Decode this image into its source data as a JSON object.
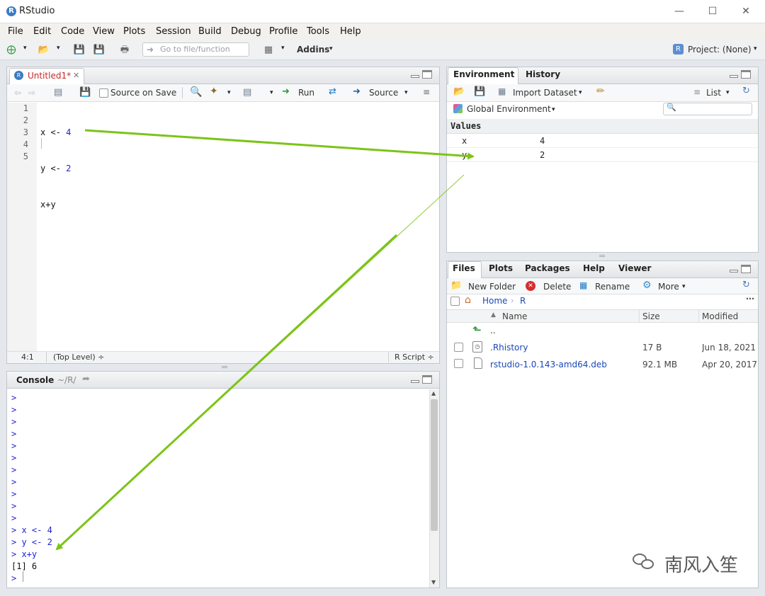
{
  "window": {
    "title": "RStudio"
  },
  "menu": [
    "File",
    "Edit",
    "Code",
    "View",
    "Plots",
    "Session",
    "Build",
    "Debug",
    "Profile",
    "Tools",
    "Help"
  ],
  "toolbar": {
    "goto_placeholder": "Go to file/function",
    "addins_label": "Addins",
    "project_label": "Project: (None)"
  },
  "editor": {
    "tab_label": "Untitled1*",
    "source_on_save": "Source on Save",
    "run_label": "Run",
    "source_label": "Source",
    "lines": [
      {
        "num": "1",
        "code": "x <- ",
        "val": "4"
      },
      {
        "num": "2",
        "code": "y <- ",
        "val": "2"
      },
      {
        "num": "3",
        "code": "x+y",
        "val": ""
      },
      {
        "num": "4",
        "code": "",
        "val": ""
      },
      {
        "num": "5",
        "code": "",
        "val": ""
      }
    ],
    "status_pos": "4:1",
    "status_scope": "(Top Level) ÷",
    "status_type": "R Script ÷"
  },
  "console": {
    "title": "Console",
    "path": "~/R/",
    "empty_prompts": 11,
    "prompt": ">",
    "commands": [
      "x <- 4",
      "y <- 2",
      "x+y"
    ],
    "output": "[1] 6"
  },
  "env": {
    "tabs": [
      "Environment",
      "History"
    ],
    "import_label": "Import Dataset",
    "list_label": "List",
    "scope_label": "Global Environment",
    "section": "Values",
    "vars": [
      {
        "name": "x",
        "value": "4"
      },
      {
        "name": "y",
        "value": "2"
      }
    ]
  },
  "files": {
    "tabs": [
      "Files",
      "Plots",
      "Packages",
      "Help",
      "Viewer"
    ],
    "new_folder": "New Folder",
    "delete": "Delete",
    "rename": "Rename",
    "more": "More",
    "crumb_home": "Home",
    "crumb_r": "R",
    "col_name": "Name",
    "col_size": "Size",
    "col_modified": "Modified",
    "up": "..",
    "rows": [
      {
        "name": ".Rhistory",
        "size": "17 B",
        "modified": "Jun 18, 2021"
      },
      {
        "name": "rstudio-1.0.143-amd64.deb",
        "size": "92.1 MB",
        "modified": "Apr 20, 2017"
      }
    ]
  },
  "watermark": {
    "text": "南风入笙"
  },
  "colors": {
    "code_blue": "#1d1fd6",
    "arrow_green": "#7cc417",
    "link_blue": "#1a48b8"
  }
}
